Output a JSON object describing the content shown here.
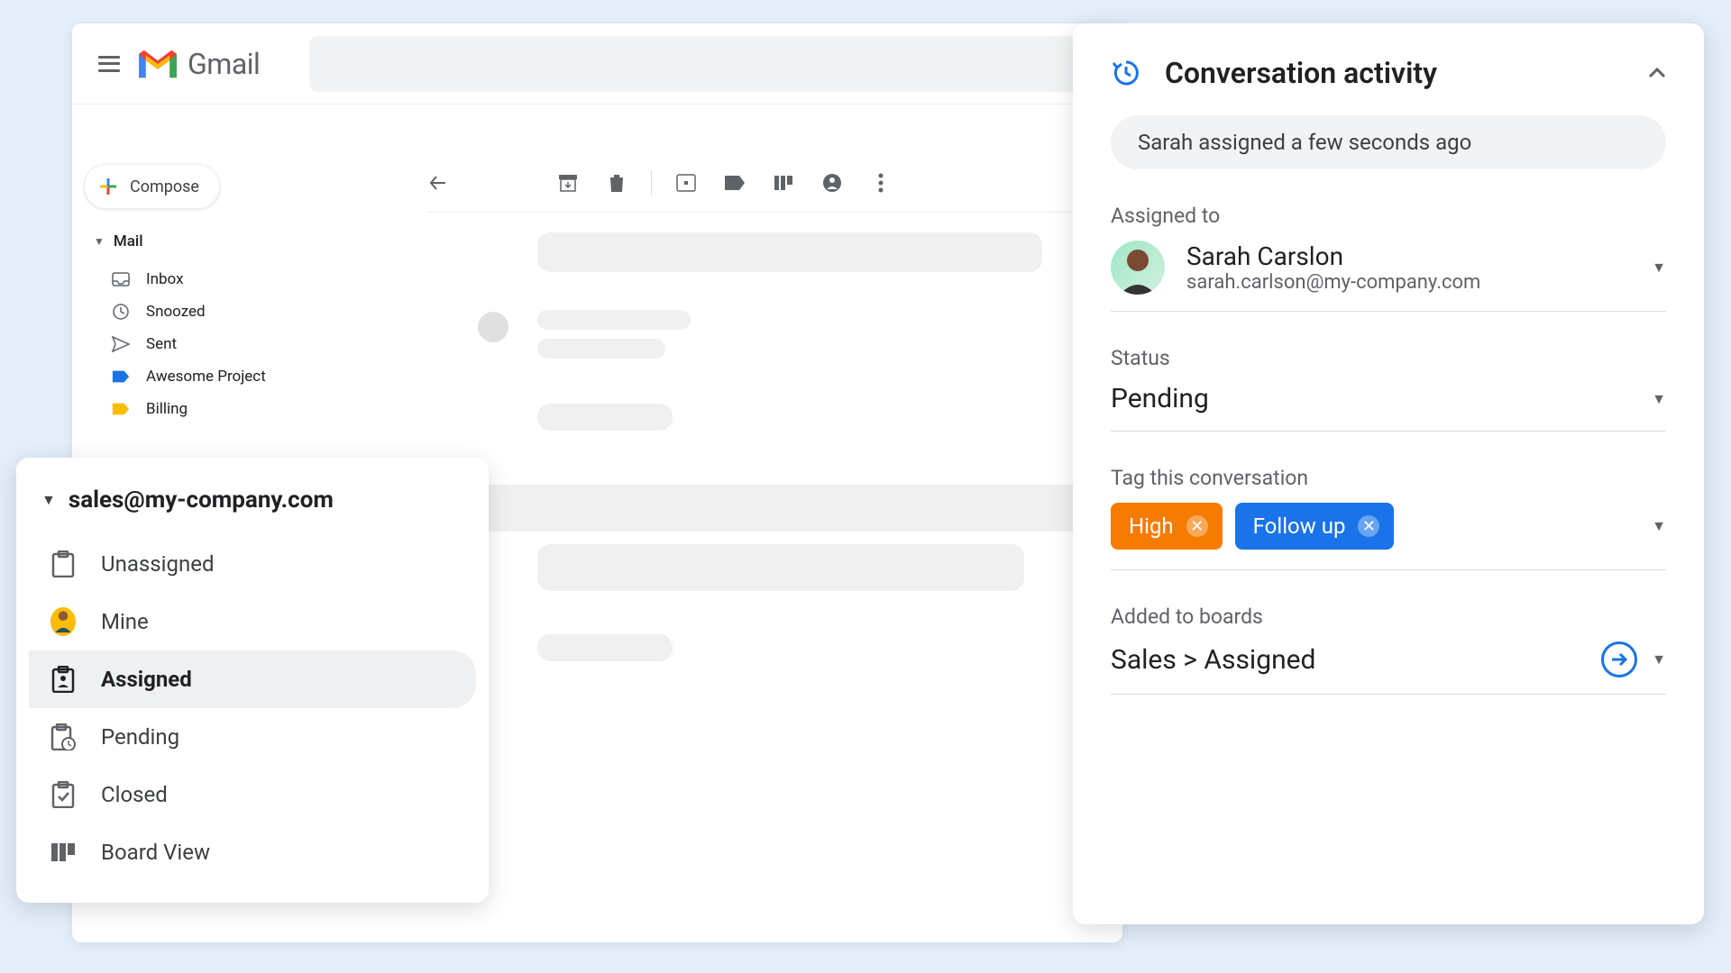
{
  "header": {
    "app_name": "Gmail"
  },
  "compose_label": "Compose",
  "mail_section": {
    "label": "Mail",
    "items": [
      {
        "label": "Inbox",
        "icon": "inbox-icon"
      },
      {
        "label": "Snoozed",
        "icon": "clock-icon"
      },
      {
        "label": "Sent",
        "icon": "send-icon"
      },
      {
        "label": "Awesome Project",
        "icon": "label-icon-blue"
      },
      {
        "label": "Billing",
        "icon": "label-icon-orange"
      }
    ]
  },
  "shared_inbox": {
    "title": "sales@my-company.com",
    "items": [
      {
        "label": "Unassigned"
      },
      {
        "label": "Mine"
      },
      {
        "label": "Assigned"
      },
      {
        "label": "Pending"
      },
      {
        "label": "Closed"
      },
      {
        "label": "Board View"
      }
    ],
    "selected_index": 2
  },
  "activity": {
    "title": "Conversation activity",
    "recent_event": "Sarah assigned a few seconds ago",
    "assigned_label": "Assigned to",
    "assigned_user": {
      "name": "Sarah Carslon",
      "email": "sarah.carlson@my-company.com"
    },
    "status_label": "Status",
    "status_value": "Pending",
    "tags_label": "Tag this conversation",
    "tags": [
      {
        "label": "High",
        "color": "high"
      },
      {
        "label": "Follow up",
        "color": "follow"
      }
    ],
    "boards_label": "Added to boards",
    "boards_value": "Sales > Assigned"
  }
}
